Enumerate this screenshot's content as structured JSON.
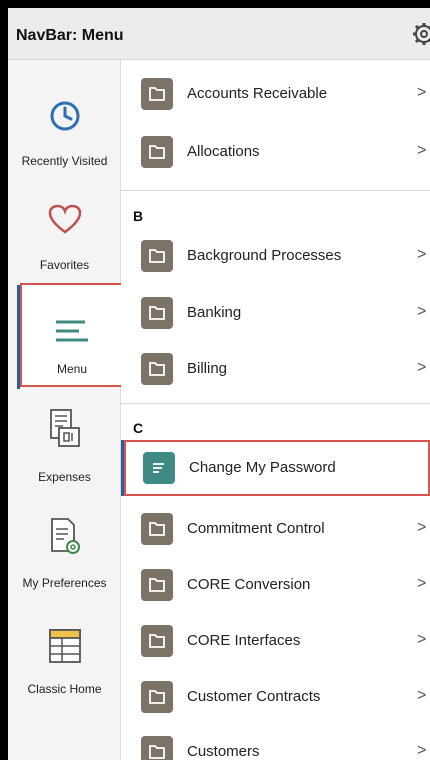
{
  "header": {
    "title": "NavBar: Menu",
    "settings_icon": "gear-icon"
  },
  "sidebar": {
    "items": [
      {
        "label": "Recently Visited",
        "icon": "clock-icon"
      },
      {
        "label": "Favorites",
        "icon": "heart-icon"
      },
      {
        "label": "Menu",
        "icon": "menu-lines-icon",
        "active": true
      },
      {
        "label": "Expenses",
        "icon": "receipt-icon"
      },
      {
        "label": "My Preferences",
        "icon": "document-gear-icon"
      },
      {
        "label": "Classic Home",
        "icon": "classic-home-icon"
      }
    ]
  },
  "menu": {
    "group_a": [
      {
        "label": "Accounts Receivable",
        "icon": "folder-icon"
      },
      {
        "label": "Allocations",
        "icon": "folder-icon"
      }
    ],
    "letter_b": "B",
    "group_b": [
      {
        "label": "Background Processes",
        "icon": "folder-icon"
      },
      {
        "label": "Banking",
        "icon": "folder-icon"
      },
      {
        "label": "Billing",
        "icon": "folder-icon"
      }
    ],
    "letter_c": "C",
    "group_c": [
      {
        "label": "Change My Password",
        "icon": "document-lines-icon",
        "selected": true
      },
      {
        "label": "Commitment Control",
        "icon": "folder-icon"
      },
      {
        "label": "CORE Conversion",
        "icon": "folder-icon"
      },
      {
        "label": "CORE Interfaces",
        "icon": "folder-icon"
      },
      {
        "label": "Customer Contracts",
        "icon": "folder-icon"
      },
      {
        "label": "Customers",
        "icon": "folder-icon"
      }
    ],
    "chevron": ">"
  },
  "colors": {
    "folder_tile": "#7b7367",
    "selected_tile": "#3f8a82",
    "highlight_border": "#d9534f",
    "active_bar": "#2a5f9e",
    "clock_blue": "#2f6fb0",
    "heart_red": "#c0504d"
  }
}
